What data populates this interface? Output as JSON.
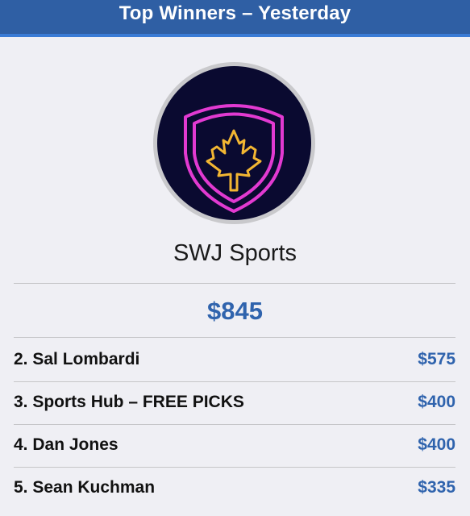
{
  "header": {
    "title": "Top Winners – Yesterday"
  },
  "top_winner": {
    "name": "SWJ Sports",
    "amount": "$845",
    "logo_icon": "maple-leaf-shield-icon"
  },
  "rows": [
    {
      "name": "2. Sal Lombardi",
      "amount": "$575"
    },
    {
      "name": "3. Sports Hub – FREE PICKS",
      "amount": "$400"
    },
    {
      "name": "4. Dan Jones",
      "amount": "$400"
    },
    {
      "name": "5. Sean Kuchman",
      "amount": "$335"
    }
  ],
  "colors": {
    "header_bg": "#2f5fa4",
    "header_accent": "#3a7bd5",
    "amount": "#2f63ad",
    "page_bg": "#efeff4",
    "logo_bg": "#0a0a30",
    "logo_shield": "#e23ad1",
    "logo_leaf": "#f2b632"
  }
}
